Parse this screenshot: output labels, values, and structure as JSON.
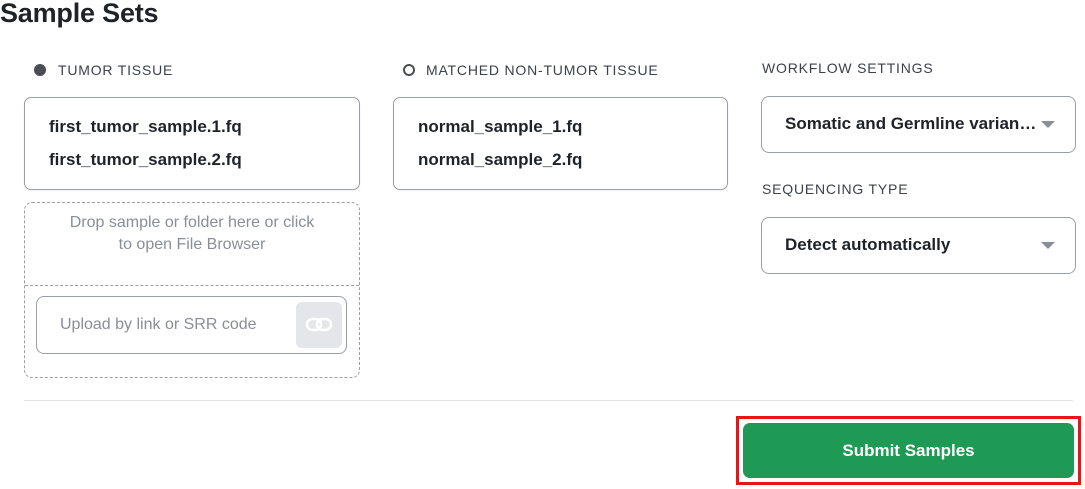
{
  "page": {
    "title": "Sample Sets"
  },
  "tumor": {
    "label": "TUMOR TISSUE",
    "files": [
      "first_tumor_sample.1.fq",
      "first_tumor_sample.2.fq"
    ],
    "drop_text": "Drop sample or folder here or click to open File Browser",
    "link_placeholder": "Upload by link or SRR code",
    "link_icon": "link-icon"
  },
  "normal": {
    "label": "MATCHED NON-TUMOR TISSUE",
    "files": [
      "normal_sample_1.fq",
      "normal_sample_2.fq"
    ]
  },
  "workflow": {
    "label": "WORKFLOW SETTINGS",
    "selected": "Somatic and Germline variant calling"
  },
  "sequencing": {
    "label": "SEQUENCING TYPE",
    "selected": "Detect automatically"
  },
  "actions": {
    "submit_label": "Submit Samples"
  },
  "colors": {
    "submit_bg": "#1f9a55",
    "highlight_border": "#e8141c",
    "radio": "#4a4d52"
  }
}
